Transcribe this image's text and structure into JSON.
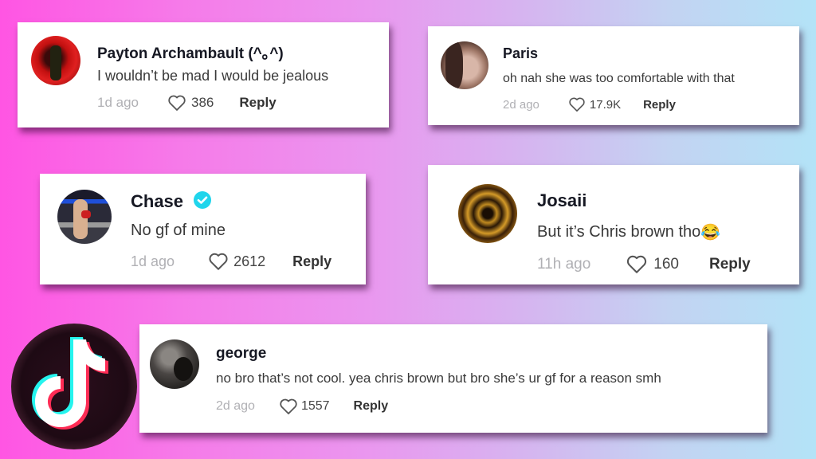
{
  "comments": [
    {
      "username": "Payton Archambault (^｡^)",
      "text": "I wouldn’t be mad I would be jealous",
      "time": "1d ago",
      "likes": "386",
      "reply_label": "Reply",
      "verified": false,
      "avatar_icon": "avatar-red-photo"
    },
    {
      "username": "Paris",
      "text": "oh nah she was too comfortable with that",
      "time": "2d ago",
      "likes": "17.9K",
      "reply_label": "Reply",
      "verified": false,
      "avatar_icon": "avatar-face-photo"
    },
    {
      "username": "Chase",
      "text": "No gf of mine",
      "time": "1d ago",
      "likes": "2612",
      "reply_label": "Reply",
      "verified": true,
      "avatar_icon": "avatar-boxing-photo"
    },
    {
      "username": "Josaii",
      "text": "But it’s Chris brown tho",
      "emoji": "😂",
      "time": "11h ago",
      "likes": "160",
      "reply_label": "Reply",
      "verified": false,
      "avatar_icon": "avatar-gold-pattern"
    },
    {
      "username": "george",
      "text": "no bro that’s not cool. yea chris brown but bro she’s ur gf for a reason smh",
      "time": "2d ago",
      "likes": "1557",
      "reply_label": "Reply",
      "verified": false,
      "avatar_icon": "avatar-dark-photo"
    }
  ],
  "logo": {
    "icon": "tiktok-logo"
  },
  "colors": {
    "background_left": "#ff55e3",
    "background_right": "#b3e3f7",
    "verified_badge": "#20d5ec",
    "tiktok_cyan": "#25f4ee",
    "tiktok_red": "#fe2c55",
    "logo_circle": "#1e0a14"
  }
}
